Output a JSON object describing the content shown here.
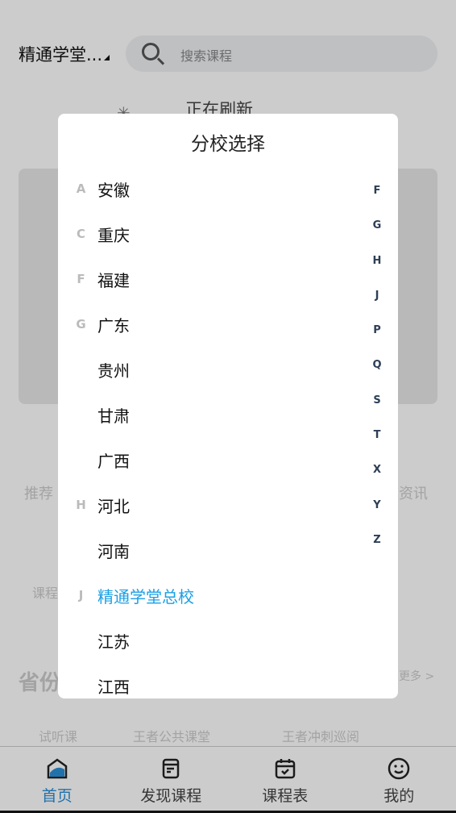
{
  "header": {
    "school": "精通学堂...",
    "search_placeholder": "搜索课程"
  },
  "refresh": {
    "text": "正在刷新"
  },
  "background_labels": [
    "推荐",
    "资讯",
    "课程",
    "省份",
    "更多 >",
    "试听课",
    "王者公共课堂",
    "王者冲刺巡阅"
  ],
  "dialog": {
    "title": "分校选择",
    "items": [
      {
        "letter": "A",
        "name": "安徽"
      },
      {
        "letter": "C",
        "name": "重庆"
      },
      {
        "letter": "F",
        "name": "福建"
      },
      {
        "letter": "G",
        "name": "广东"
      },
      {
        "letter": "",
        "name": "贵州"
      },
      {
        "letter": "",
        "name": "甘肃"
      },
      {
        "letter": "",
        "name": "广西"
      },
      {
        "letter": "H",
        "name": "河北"
      },
      {
        "letter": "",
        "name": "河南"
      },
      {
        "letter": "J",
        "name": "精通学堂总校",
        "selected": true
      },
      {
        "letter": "",
        "name": "江苏"
      },
      {
        "letter": "",
        "name": "江西"
      }
    ],
    "index": [
      "F",
      "G",
      "H",
      "J",
      "P",
      "Q",
      "S",
      "T",
      "X",
      "Y",
      "Z"
    ],
    "selected_color": "#1aa0e6"
  },
  "tabbar": {
    "items": [
      {
        "label": "首页",
        "icon": "home-icon",
        "active": true
      },
      {
        "label": "发现课程",
        "icon": "book-icon"
      },
      {
        "label": "课程表",
        "icon": "calendar-check-icon"
      },
      {
        "label": "我的",
        "icon": "smiley-icon"
      }
    ],
    "active_color": "#2a8fd6"
  }
}
